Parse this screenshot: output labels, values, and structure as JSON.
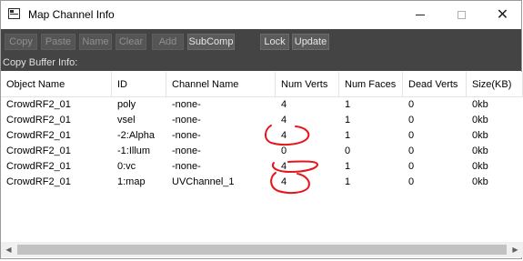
{
  "window": {
    "title": "Map Channel Info",
    "close_glyph": "✕"
  },
  "toolbar": {
    "buttons": [
      {
        "label": "Copy",
        "enabled": false
      },
      {
        "label": "Paste",
        "enabled": false
      },
      {
        "label": "Name",
        "enabled": false
      },
      {
        "label": "Clear",
        "enabled": false
      },
      {
        "label": "Add",
        "enabled": false
      },
      {
        "label": "SubComp",
        "enabled": true
      },
      {
        "label": "Lock",
        "enabled": true
      },
      {
        "label": "Update",
        "enabled": true
      }
    ]
  },
  "copy_buffer_label": "Copy Buffer Info:",
  "table": {
    "columns": [
      "Object Name",
      "ID",
      "Channel Name",
      "Num Verts",
      "Num Faces",
      "Dead Verts",
      "Size(KB)"
    ],
    "rows": [
      [
        "CrowdRF2_01",
        "poly",
        "-none-",
        "4",
        "1",
        "0",
        "0kb"
      ],
      [
        "CrowdRF2_01",
        "vsel",
        "-none-",
        "4",
        "1",
        "0",
        "0kb"
      ],
      [
        "CrowdRF2_01",
        "-2:Alpha",
        "-none-",
        "4",
        "1",
        "0",
        "0kb"
      ],
      [
        "CrowdRF2_01",
        "-1:Illum",
        "-none-",
        "0",
        "0",
        "0",
        "0kb"
      ],
      [
        "CrowdRF2_01",
        "0:vc",
        "-none-",
        "4",
        "1",
        "0",
        "0kb"
      ],
      [
        "CrowdRF2_01",
        "1:map",
        "UVChannel_1",
        "4",
        "1",
        "0",
        "0kb"
      ]
    ]
  },
  "annotations": {
    "color": "#e8141b"
  },
  "icons": {
    "app": "map-channel-icon",
    "minimize": "minimize-icon",
    "maximize": "maximize-icon",
    "close": "close-icon",
    "scroll_left": "chevron-left-icon",
    "scroll_right": "chevron-right-icon"
  }
}
